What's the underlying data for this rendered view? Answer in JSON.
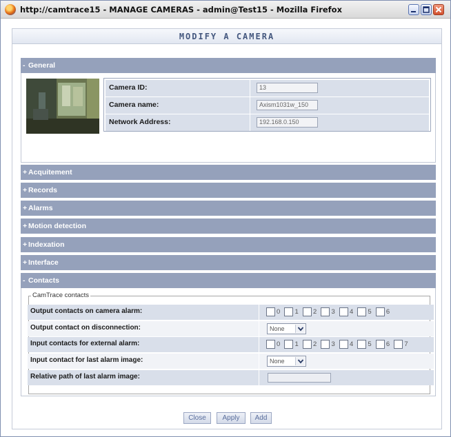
{
  "window": {
    "title": "http://camtrace15 - MANAGE CAMERAS - admin@Test15 - Mozilla Firefox"
  },
  "page": {
    "header": "MODIFY A CAMERA"
  },
  "general": {
    "label": "General",
    "sign": "-",
    "fields": [
      {
        "label": "Camera ID:",
        "value": "13"
      },
      {
        "label": "Camera name:",
        "value": "Axism1031w_150"
      },
      {
        "label": "Network Address:",
        "value": "192.168.0.150"
      }
    ]
  },
  "sections": [
    {
      "label": "Acquitement",
      "sign": "+"
    },
    {
      "label": "Records",
      "sign": "+"
    },
    {
      "label": "Alarms",
      "sign": "+"
    },
    {
      "label": "Motion detection",
      "sign": "+"
    },
    {
      "label": "Indexation",
      "sign": "+"
    },
    {
      "label": "Interface",
      "sign": "+"
    }
  ],
  "contacts": {
    "label": "Contacts",
    "sign": "-",
    "legend": "CamTrace contacts",
    "rows": [
      {
        "label": "Output contacts on camera alarm:",
        "numbers": [
          "0",
          "1",
          "2",
          "3",
          "4",
          "5",
          "6"
        ]
      },
      {
        "label": "Output contact on disconnection:",
        "select": "None"
      },
      {
        "label": "Input contacts for external alarm:",
        "numbers": [
          "0",
          "1",
          "2",
          "3",
          "4",
          "5",
          "6",
          "7"
        ]
      },
      {
        "label": "Input contact for last alarm image:",
        "select": "None"
      },
      {
        "label": "Relative path of last alarm image:",
        "value": ""
      }
    ]
  },
  "buttons": {
    "close": "Close",
    "apply": "Apply",
    "add": "Add"
  },
  "colors": {
    "section_bar": "#95a1bb",
    "row_bg": "#d9dfea",
    "header_text": "#45587f"
  },
  "icons": [
    "firefox-icon",
    "minimize-icon",
    "maximize-icon",
    "close-icon",
    "chevron-down-icon"
  ]
}
